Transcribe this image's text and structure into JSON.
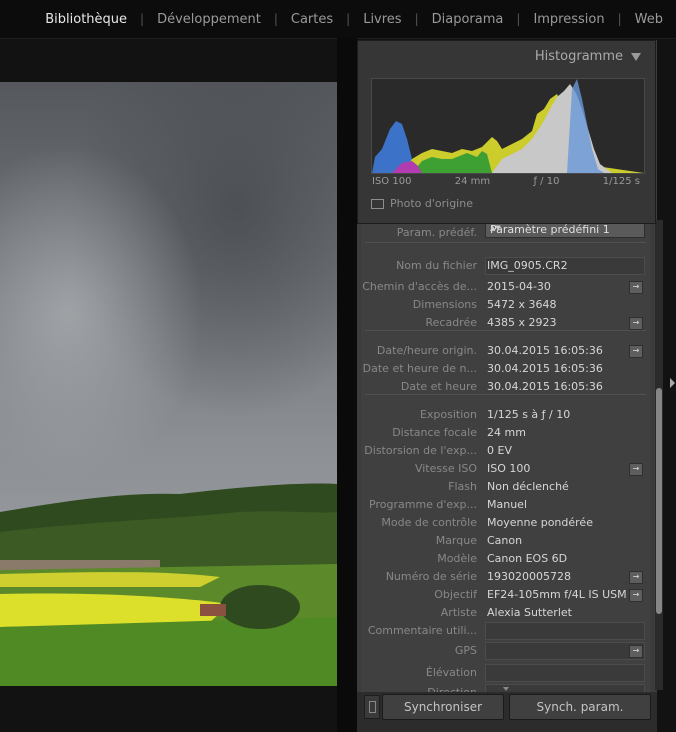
{
  "modules": [
    {
      "label": "Bibliothèque",
      "active": true
    },
    {
      "label": "Développement",
      "active": false
    },
    {
      "label": "Cartes",
      "active": false
    },
    {
      "label": "Livres",
      "active": false
    },
    {
      "label": "Diaporama",
      "active": false
    },
    {
      "label": "Impression",
      "active": false
    },
    {
      "label": "Web",
      "active": false
    }
  ],
  "histogram": {
    "title": "Histogramme",
    "iso": "ISO 100",
    "focal": "24 mm",
    "aperture": "ƒ / 10",
    "shutter": "1/125 s",
    "original_photo": "Photo d'origine"
  },
  "metadata": {
    "preset_label": "Param. prédéf.",
    "preset_value": "Paramètre prédéfini 1",
    "rows": [
      {
        "label": "Nom du fichier",
        "value": "IMG_0905.CR2"
      },
      {
        "label": "Chemin d'accès de...",
        "value": "2015-04-30"
      },
      {
        "label": "Dimensions",
        "value": "5472 x 3648"
      },
      {
        "label": "Recadrée",
        "value": "4385 x 2923"
      },
      {
        "label": "Date/heure origin.",
        "value": "30.04.2015 16:05:36"
      },
      {
        "label": "Date et heure de n...",
        "value": "30.04.2015 16:05:36"
      },
      {
        "label": "Date et heure",
        "value": "30.04.2015 16:05:36"
      },
      {
        "label": "Exposition",
        "value": "1/125 s à ƒ / 10"
      },
      {
        "label": "Distance focale",
        "value": "24 mm"
      },
      {
        "label": "Distorsion de l'exp...",
        "value": "0 EV"
      },
      {
        "label": "Vitesse ISO",
        "value": "ISO 100"
      },
      {
        "label": "Flash",
        "value": "Non déclenché"
      },
      {
        "label": "Programme d'exp...",
        "value": "Manuel"
      },
      {
        "label": "Mode de contrôle",
        "value": "Moyenne pondérée"
      },
      {
        "label": "Marque",
        "value": "Canon"
      },
      {
        "label": "Modèle",
        "value": "Canon EOS 6D"
      },
      {
        "label": "Numéro de série",
        "value": "193020005728"
      },
      {
        "label": "Objectif",
        "value": "EF24-105mm f/4L IS USM"
      },
      {
        "label": "Artiste",
        "value": "Alexia Sutterlet"
      },
      {
        "label": "Commentaire utili...",
        "value": ""
      },
      {
        "label": "GPS",
        "value": ""
      },
      {
        "label": "Élévation",
        "value": ""
      },
      {
        "label": "Direction",
        "value": ""
      }
    ]
  },
  "buttons": {
    "sync": "Synchroniser",
    "sync_settings": "Synch. param."
  },
  "icons": {
    "arrow": "→",
    "updown": "▲▼"
  }
}
